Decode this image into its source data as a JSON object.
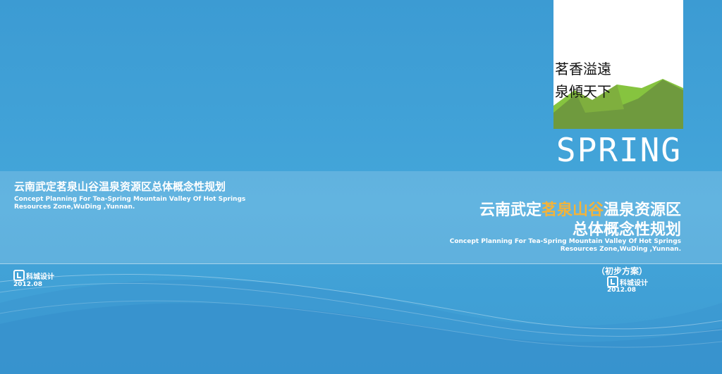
{
  "colors": {
    "background": "#3ea0d6",
    "highlight": "#f3b33a",
    "hill_light": "#86c43f",
    "hill_dark": "#6f9a3e"
  },
  "logo_card": {
    "slogan_line1": "茗香溢遠",
    "slogan_line2": "泉傾天下",
    "spring_word": "SPRING"
  },
  "left_block": {
    "title_cn": "云南武定茗泉山谷温泉资源区总体概念性规划",
    "title_en_line1": "Concept Planning For Tea-Spring Mountain Valley Of Hot Springs",
    "title_en_line2": "Resources Zone,WuDing ,Yunnan.",
    "company_logo": "科城设计",
    "date": "2012.08"
  },
  "right_block": {
    "title_line1_pre": "云南武定",
    "title_line1_highlight": "茗泉山谷",
    "title_line1_post": "温泉资源区",
    "title_line2": "总体概念性规划",
    "title_en_line1": "Concept Planning For Tea-Spring Mountain Valley Of Hot Springs",
    "title_en_line2": "Resources Zone,WuDing ,Yunnan.",
    "note": "（初步方案）",
    "company_logo": "科城设计",
    "date": "2012.08"
  }
}
